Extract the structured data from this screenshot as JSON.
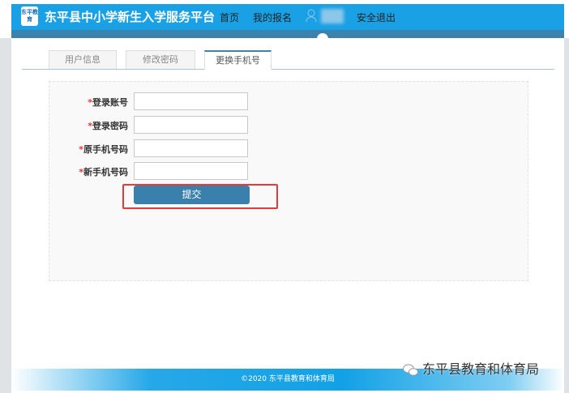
{
  "header": {
    "logo_text": "东平教育",
    "title": "东平县中小学新生入学服务平台",
    "nav": [
      "首页",
      "我的报名"
    ],
    "logout": "安全退出"
  },
  "tabs": [
    {
      "label": "用户信息"
    },
    {
      "label": "修改密码"
    },
    {
      "label": "更换手机号",
      "active": true
    }
  ],
  "form": {
    "required_mark": "*",
    "fields": [
      {
        "label": "登录账号",
        "value": ""
      },
      {
        "label": "登录密码",
        "value": ""
      },
      {
        "label": "原手机号码",
        "value": ""
      },
      {
        "label": "新手机号码",
        "value": ""
      }
    ],
    "submit": "提交"
  },
  "footer": {
    "text": "©2020  东平县教育和体育局"
  },
  "watermark": {
    "text": "东平县教育和体育局"
  },
  "colors": {
    "header": "#1aa0e4",
    "band": "#3b82ad",
    "button": "#3a80ad",
    "highlight": "#e23b3b"
  }
}
